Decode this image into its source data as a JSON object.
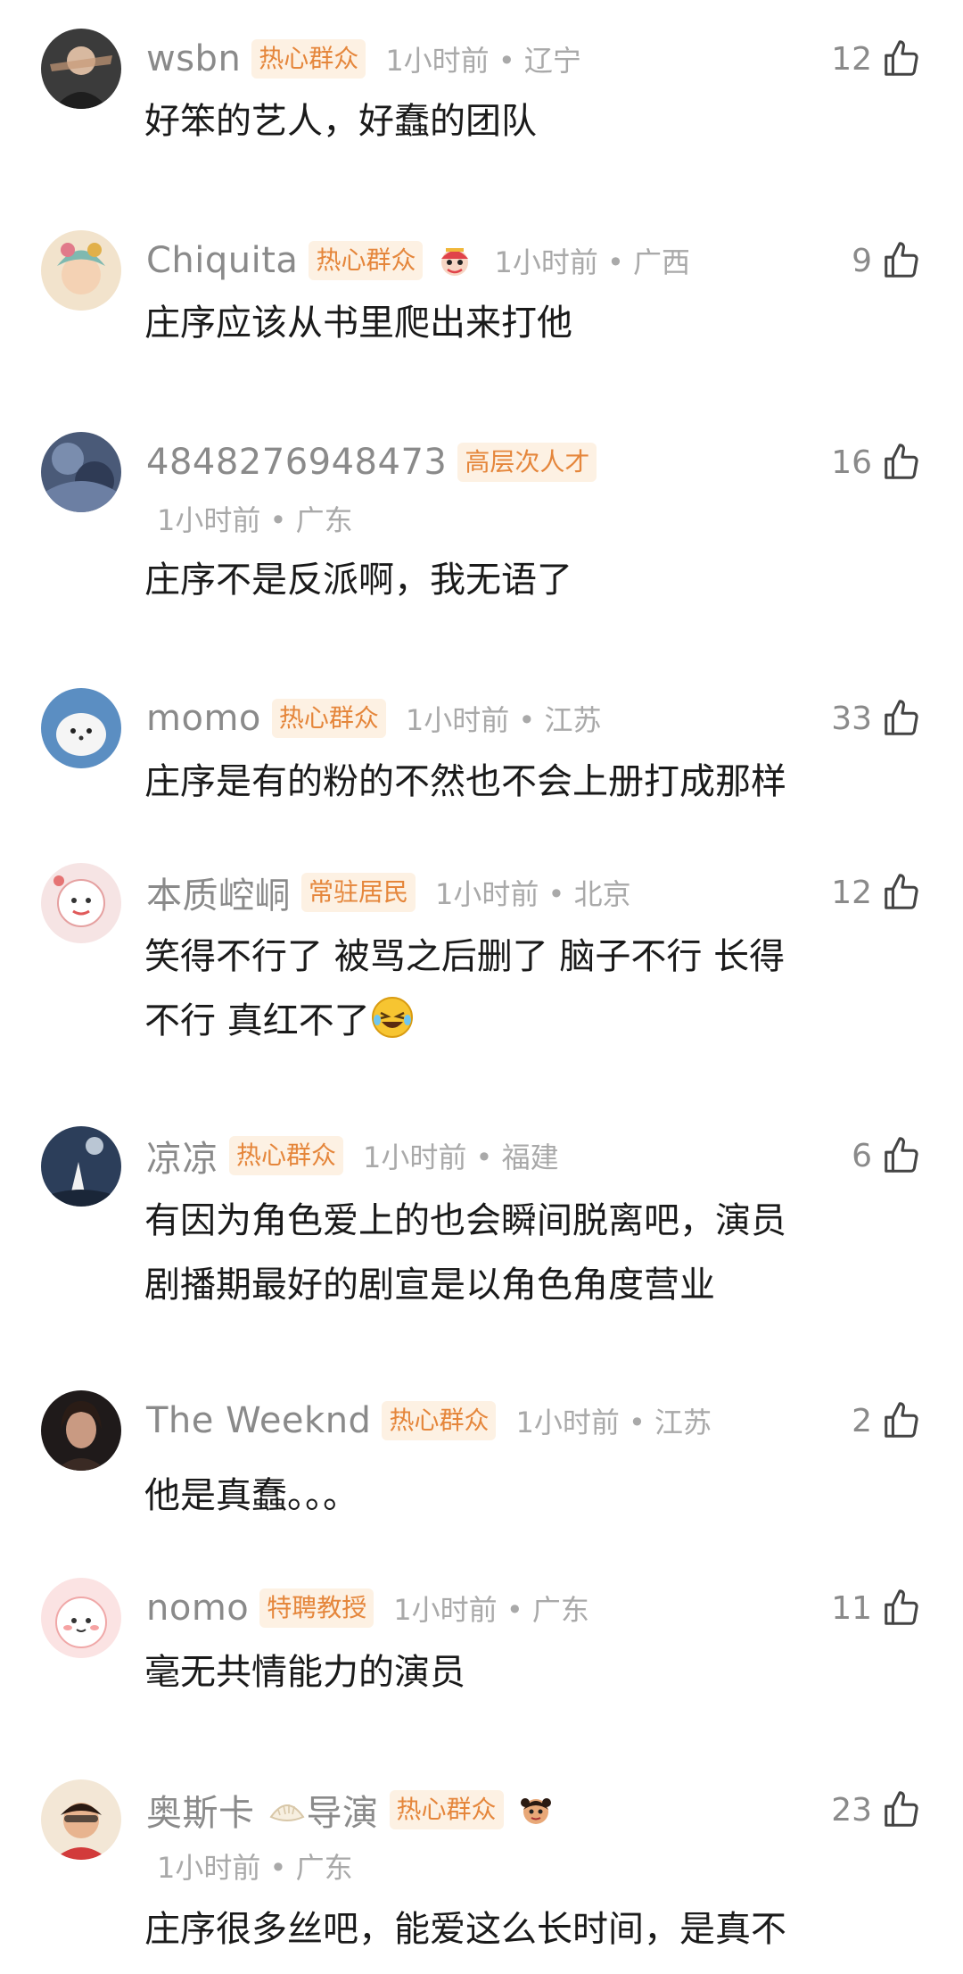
{
  "comments": [
    {
      "username": "wsbn",
      "badge": "热心群众",
      "time": "1小时前 • 辽宁",
      "likes": "12",
      "text": [
        "好笨的艺人，好蠢的团队"
      ],
      "avatar_color": "#3b3b3b"
    },
    {
      "username": "Chiquita",
      "badge": "热心群众",
      "time": "1小时前 • 广西",
      "likes": "9",
      "text": [
        "庄序应该从书里爬出来打他"
      ],
      "avatar_color": "#e8c9a0",
      "deco_icon": "lion-dance-icon"
    },
    {
      "username": "4848276948473",
      "badge": "高层次人才",
      "time": "1小时前 • 广东",
      "likes": "16",
      "text": [
        "庄序不是反派啊，我无语了"
      ],
      "avatar_color": "#4a5a78"
    },
    {
      "username": "momo",
      "badge": "热心群众",
      "time": "1小时前 • 江苏",
      "likes": "33",
      "text": [
        "庄序是有的粉的不然也不会上册打成那样"
      ],
      "avatar_color": "#5b8ec2"
    },
    {
      "username": "本质崆峒",
      "badge": "常驻居民",
      "time": "1小时前 • 北京",
      "likes": "12",
      "text": [
        "笑得不行了 被骂之后删了 脑子不行 长得",
        "不行 真红不了"
      ],
      "avatar_color": "#f3d6d6",
      "emoji_icon": "laughing-emoji-icon"
    },
    {
      "username": "凉凉",
      "badge": "热心群众",
      "time": "1小时前 • 福建",
      "likes": "6",
      "text": [
        "有因为角色爱上的也会瞬间脱离吧，演员",
        "剧播期最好的剧宣是以角色角度营业"
      ],
      "avatar_color": "#2c3e5a"
    },
    {
      "username": "The Weeknd",
      "badge": "热心群众",
      "time": "1小时前 • 江苏",
      "likes": "2",
      "text": [
        "他是真蠢。。。"
      ],
      "avatar_color": "#5a4238"
    },
    {
      "username": "nomo",
      "badge": "特聘教授",
      "time": "1小时前 • 广东",
      "likes": "11",
      "text": [
        "毫无共情能力的演员"
      ],
      "avatar_color": "#f6c8c8"
    },
    {
      "username": "奥斯卡",
      "username_suffix": "导演",
      "badge": "热心群众",
      "time": "1小时前 • 广东",
      "likes": "23",
      "text": [
        "庄序很多丝吧，能爱这么长时间，是真不"
      ],
      "avatar_color": "#e9d4b8",
      "deco_icon": "cartoon-face-icon"
    }
  ],
  "icons": {
    "like": "thumbs-up-icon"
  },
  "colors": {
    "badge_bg": "#fdf1e3",
    "badge_text": "#e5863b",
    "username": "#8a8a8a",
    "meta": "#a9a9a9",
    "text": "#1a1a1a"
  }
}
